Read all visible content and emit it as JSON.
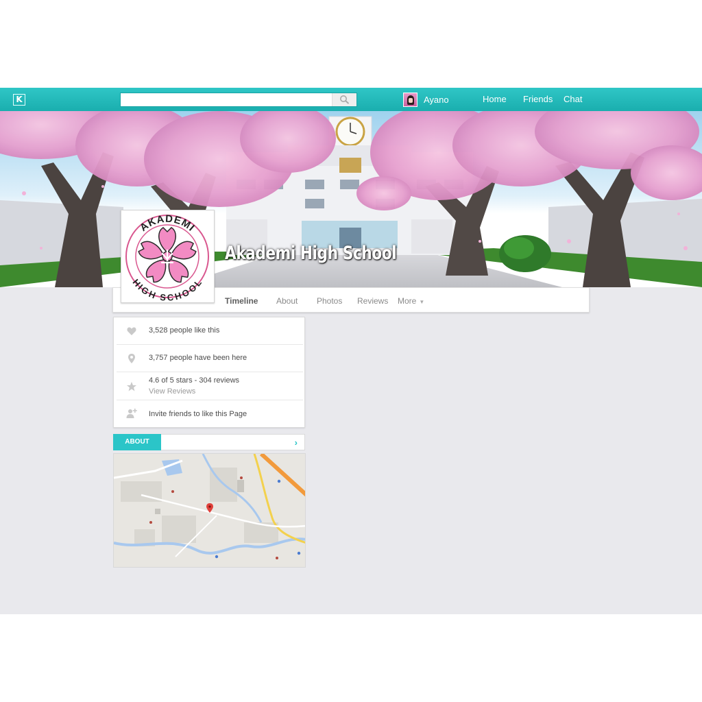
{
  "topbar": {
    "logo_text": "K",
    "search_placeholder": "",
    "user_name": "Ayano",
    "nav": {
      "home": "Home",
      "friends": "Friends",
      "chat": "Chat"
    }
  },
  "page": {
    "title": "Akademi High School",
    "logo_text_top": "AKADEMI",
    "logo_text_bottom": "HIGH SCHOOL"
  },
  "tabs": {
    "timeline": "Timeline",
    "about": "About",
    "photos": "Photos",
    "reviews": "Reviews",
    "more": "More",
    "more_caret": "▼"
  },
  "info": {
    "likes": "3,528 people like this",
    "visits": "3,757 people have been here",
    "rating": "4.6 of 5 stars - 304 reviews",
    "view_reviews": "View Reviews",
    "invite": "Invite friends to like this Page"
  },
  "about": {
    "label": "ABOUT",
    "arrow": "›"
  },
  "colors": {
    "accent": "#2bc5c8",
    "topbar": "#1fb4b4",
    "background": "#e9e9ed",
    "blossom": "#f4a8d4",
    "logo_pink": "#f28bc3"
  },
  "icons": [
    "search-icon",
    "heart-icon",
    "map-pin-icon",
    "star-icon",
    "add-friend-icon",
    "chevron-right-icon"
  ]
}
